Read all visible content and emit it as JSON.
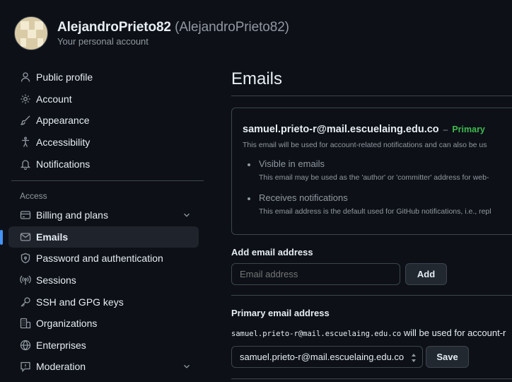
{
  "header": {
    "username": "AlejandroPrieto82",
    "handle": "(AlejandroPrieto82)",
    "subtitle": "Your personal account"
  },
  "sidebar": {
    "items_top": [
      {
        "label": "Public profile",
        "icon": "person-icon"
      },
      {
        "label": "Account",
        "icon": "gear-icon"
      },
      {
        "label": "Appearance",
        "icon": "paintbrush-icon"
      },
      {
        "label": "Accessibility",
        "icon": "accessibility-icon"
      },
      {
        "label": "Notifications",
        "icon": "bell-icon"
      }
    ],
    "section_label": "Access",
    "items_access": [
      {
        "label": "Billing and plans",
        "icon": "credit-card-icon",
        "expandable": true
      },
      {
        "label": "Emails",
        "icon": "mail-icon",
        "active": true
      },
      {
        "label": "Password and authentication",
        "icon": "shield-lock-icon"
      },
      {
        "label": "Sessions",
        "icon": "broadcast-icon"
      },
      {
        "label": "SSH and GPG keys",
        "icon": "key-icon"
      },
      {
        "label": "Organizations",
        "icon": "organization-icon"
      },
      {
        "label": "Enterprises",
        "icon": "globe-icon"
      },
      {
        "label": "Moderation",
        "icon": "report-icon",
        "expandable": true
      }
    ]
  },
  "main": {
    "title": "Emails",
    "email_card": {
      "email": "samuel.prieto-r@mail.escuelaing.edu.co",
      "dash": "–",
      "primary_label": "Primary",
      "description": "This email will be used for account-related notifications and can also be us",
      "bullets": [
        {
          "title": "Visible in emails",
          "desc": "This email may be used as the 'author' or 'committer' address for web-"
        },
        {
          "title": "Receives notifications",
          "desc": "This email address is the default used for GitHub notifications, i.e., repl"
        }
      ]
    },
    "add_email": {
      "title": "Add email address",
      "placeholder": "Email address",
      "button": "Add"
    },
    "primary_email": {
      "title": "Primary email address",
      "mono_email": "samuel.prieto-r@mail.escuelaing.edu.co",
      "rest_text": " will be used for account-r",
      "selected": "samuel.prieto-r@mail.escuelaing.edu.co",
      "button": "Save"
    }
  },
  "colors": {
    "background": "#0d1117",
    "accent": "#4493f8",
    "primary_badge": "#3fb950",
    "border": "#3d444d",
    "muted": "#9198a1"
  }
}
